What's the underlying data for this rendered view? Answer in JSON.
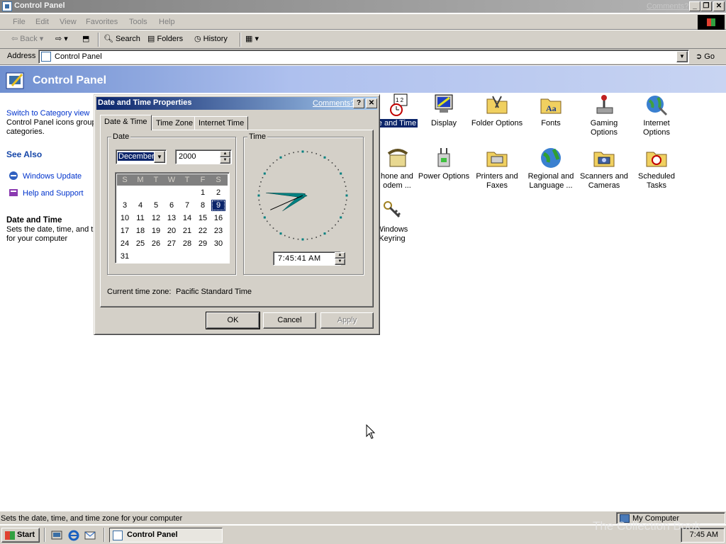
{
  "window": {
    "title": "Control Panel",
    "comments": "Comments?"
  },
  "menu": [
    "File",
    "Edit",
    "View",
    "Favorites",
    "Tools",
    "Help"
  ],
  "toolbar": {
    "back": "Back",
    "search": "Search",
    "folders": "Folders",
    "history": "History"
  },
  "address": {
    "label": "Address",
    "value": "Control Panel",
    "go": "Go"
  },
  "header": {
    "title": "Control Panel"
  },
  "left_pane": {
    "switch_link": "Switch to Category view",
    "desc_line1": "Control Panel icons group",
    "desc_line2": "categories.",
    "see_also": "See Also",
    "links": [
      "Windows Update",
      "Help and Support"
    ],
    "info_title": "Date and Time",
    "info_line1": "Sets the date, time, and t",
    "info_line2": "for your computer"
  },
  "icons": [
    {
      "l1": "e and Time",
      "l2": ""
    },
    {
      "l1": "Display",
      "l2": ""
    },
    {
      "l1": "Folder Options",
      "l2": ""
    },
    {
      "l1": "Fonts",
      "l2": ""
    },
    {
      "l1": "Gaming",
      "l2": "Options"
    },
    {
      "l1": "Internet",
      "l2": "Options"
    },
    {
      "l1": "hone and",
      "l2": "odem ..."
    },
    {
      "l1": "Power Options",
      "l2": ""
    },
    {
      "l1": "Printers and",
      "l2": "Faxes"
    },
    {
      "l1": "Regional and",
      "l2": "Language ..."
    },
    {
      "l1": "Scanners and",
      "l2": "Cameras"
    },
    {
      "l1": "Scheduled",
      "l2": "Tasks"
    },
    {
      "l1": "Windows",
      "l2": "Keyring"
    }
  ],
  "dialog": {
    "title": "Date and Time Properties",
    "comments": "Comments?",
    "tabs": [
      "Date & Time",
      "Time Zone",
      "Internet Time"
    ],
    "date_group": "Date",
    "time_group": "Time",
    "month": "December",
    "year": "2000",
    "weekdays": [
      "S",
      "M",
      "T",
      "W",
      "T",
      "F",
      "S"
    ],
    "selected_day": "9",
    "time": "7:45:41 AM",
    "timezone_label": "Current time zone:",
    "timezone": "Pacific Standard Time",
    "ok": "OK",
    "cancel": "Cancel",
    "apply": "Apply",
    "clock": {
      "hour": 7,
      "minute": 45,
      "second": 41
    }
  },
  "status": {
    "text": "Sets the date, time, and time zone for your computer",
    "zone": "My Computer"
  },
  "taskbar": {
    "start": "Start",
    "task": "Control Panel",
    "clock": "7:45 AM"
  },
  "watermark": "The Collection Book",
  "colors": {
    "title_active": "#0a246a",
    "selection": "#0a246a",
    "face": "#d4d0c8"
  }
}
